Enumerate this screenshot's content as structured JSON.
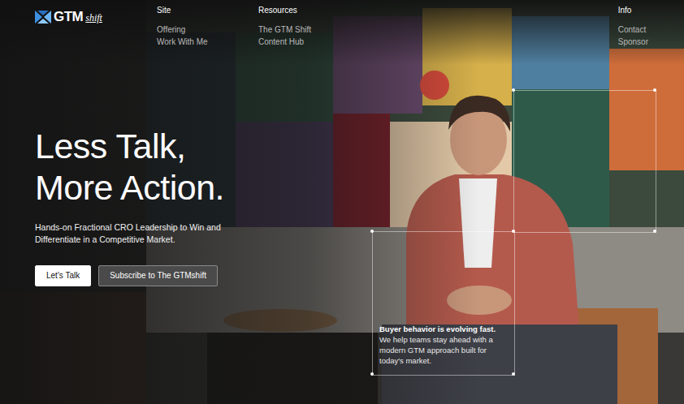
{
  "logo": {
    "text": "GTM",
    "suffix": "shift"
  },
  "nav": [
    {
      "heading": "Site",
      "items": [
        "Offering",
        "Work With Me"
      ]
    },
    {
      "heading": "Resources",
      "items": [
        "The GTM Shift",
        "Content Hub"
      ]
    },
    {
      "heading": "Info",
      "items": [
        "Contact",
        "Sponsor"
      ]
    }
  ],
  "hero": {
    "title": [
      "Less Talk,",
      "More Action."
    ],
    "subtitle": "Hands-on Fractional CRO Leadership to Win and Differentiate in a Competitive Market.",
    "buttons": [
      {
        "label": "Let's Talk",
        "kind": "primary"
      },
      {
        "label": "Subscribe to The GTMshift",
        "kind": "secondary"
      }
    ]
  },
  "caption": {
    "title": "Buyer behavior is evolving fast.",
    "body": "We help teams stay ahead with a modern GTM approach built for today's market."
  }
}
